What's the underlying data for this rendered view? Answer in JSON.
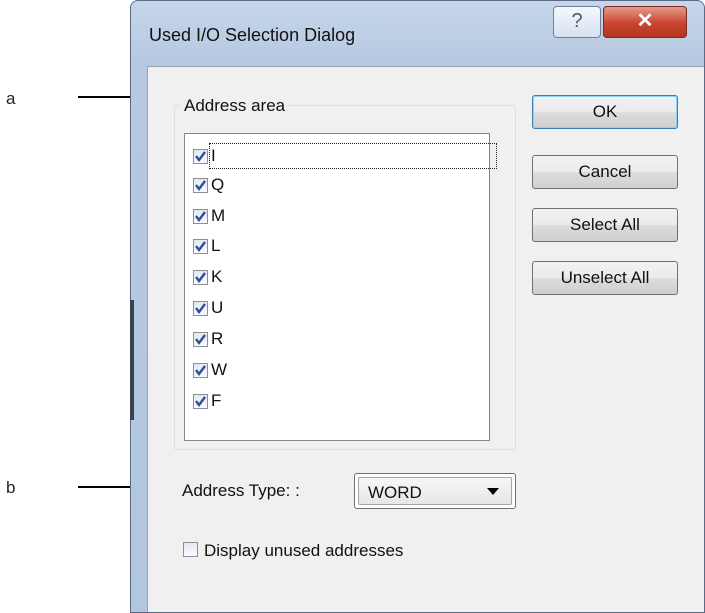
{
  "annotations": {
    "a": "a",
    "b": "b"
  },
  "dialog": {
    "title": "Used I/O Selection Dialog",
    "help_glyph": "?",
    "close_glyph": "✕"
  },
  "address_area": {
    "label": "Address area",
    "items": [
      {
        "label": "I",
        "checked": true
      },
      {
        "label": "Q",
        "checked": true
      },
      {
        "label": "M",
        "checked": true
      },
      {
        "label": "L",
        "checked": true
      },
      {
        "label": "K",
        "checked": true
      },
      {
        "label": "U",
        "checked": true
      },
      {
        "label": "R",
        "checked": true
      },
      {
        "label": "W",
        "checked": true
      },
      {
        "label": "F",
        "checked": true
      }
    ]
  },
  "buttons": {
    "ok": "OK",
    "cancel": "Cancel",
    "select_all": "Select All",
    "unselect_all": "Unselect All"
  },
  "address_type": {
    "label": "Address Type: :",
    "value": "WORD"
  },
  "display_unused": {
    "label": "Display unused addresses",
    "checked": false
  },
  "colors": {
    "close_button": "#c8452f",
    "default_button_border": "#3c7fb1",
    "check_mark": "#2f4f99"
  }
}
